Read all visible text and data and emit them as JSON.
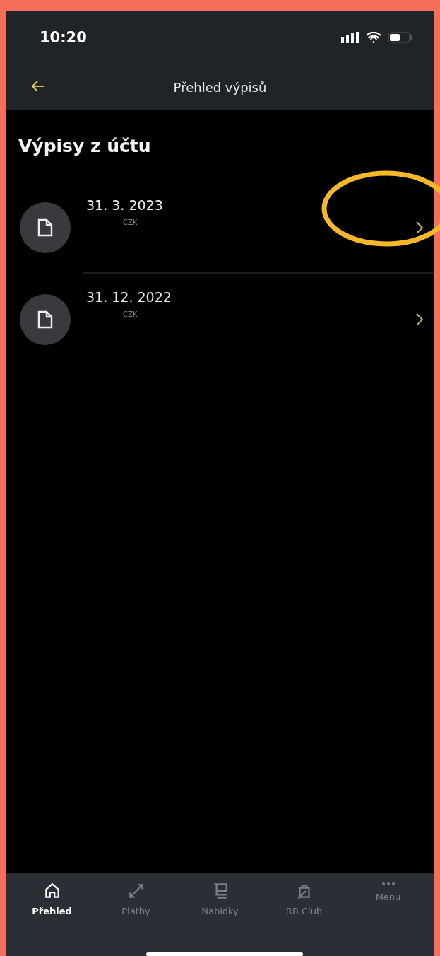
{
  "status_bar": {
    "time": "10:20"
  },
  "header": {
    "title": "Přehled výpisů"
  },
  "section": {
    "title": "Výpisy z účtu"
  },
  "statements": [
    {
      "date": "31. 3. 2023",
      "currency": "CZK",
      "highlighted": true
    },
    {
      "date": "31. 12. 2022",
      "currency": "CZK",
      "highlighted": false
    }
  ],
  "tab_bar": [
    {
      "label": "Přehled",
      "kind": "home",
      "selected": true
    },
    {
      "label": "Platby",
      "kind": "transfer",
      "selected": false
    },
    {
      "label": "Nabídky",
      "kind": "cart",
      "selected": false
    },
    {
      "label": "RB Club",
      "kind": "bag",
      "selected": false
    },
    {
      "label": "Menu",
      "kind": "more",
      "selected": false
    }
  ]
}
